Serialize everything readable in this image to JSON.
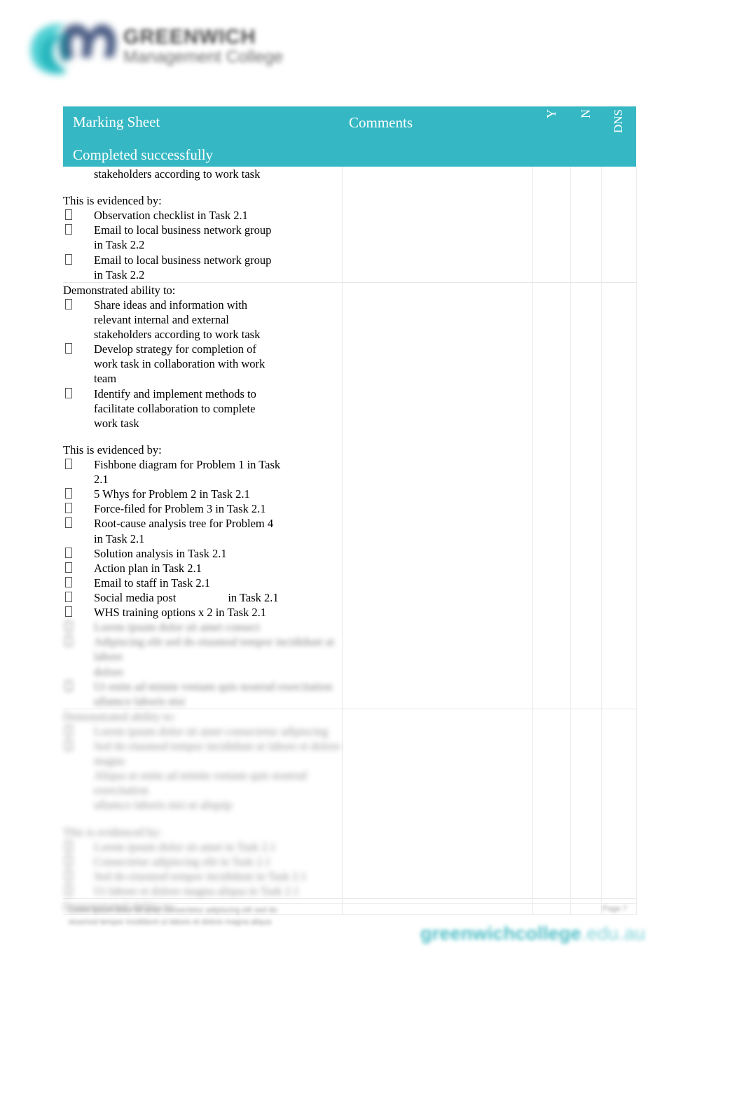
{
  "branding": {
    "logo_icon": "gm-monogram-logo",
    "name": "GREENWICH",
    "tagline": "Management College",
    "mark_colors": [
      "#3bc3c9",
      "#2aa6b4",
      "#4a5b80",
      "#6f7fa3"
    ]
  },
  "colors": {
    "header_teal": "#36b8c4",
    "footer_url_teal": "#4dbec6",
    "text": "#000000",
    "grid": "#e9e9e9"
  },
  "table": {
    "headers": {
      "title_line1": "Marking Sheet",
      "title_line2": "Completed successfully",
      "comments": "Comments",
      "yes": "Y",
      "no": "N",
      "dns": "DNS"
    },
    "rows": [
      {
        "id": "row-1",
        "continuation_line": "stakeholders according to work task",
        "evidence_lead": "This is evidenced by:",
        "evidence_items": [
          [
            "Observation checklist in Task 2.1"
          ],
          [
            "Email to local business network group",
            "in Task 2.2"
          ],
          [
            "Email to local business network group",
            "in Task 2.2"
          ]
        ]
      },
      {
        "id": "row-2",
        "ability_lead": "Demonstrated ability to:",
        "ability_items": [
          [
            "Share ideas and information with",
            "relevant internal and external",
            "stakeholders according to work task"
          ],
          [
            "Develop strategy for completion of",
            "work task in collaboration with work",
            "team"
          ],
          [
            "Identify and implement methods to",
            "facilitate collaboration to complete",
            "work task"
          ]
        ],
        "evidence_lead": "This is evidenced by:",
        "evidence_items": [
          [
            "Fishbone diagram for Problem 1 in Task",
            "2.1"
          ],
          [
            "5 Whys for Problem 2 in Task 2.1"
          ],
          [
            "Force-filed for Problem 3 in Task 2.1"
          ],
          [
            "Root-cause analysis tree for Problem 4",
            "in Task 2.1"
          ],
          [
            "Solution analysis in Task 2.1"
          ],
          [
            "Action plan in Task 2.1"
          ],
          [
            "Email to staff in Task 2.1"
          ],
          [
            "Social media post",
            "in Task 2.1"
          ],
          [
            "WHS training options x 2 in Task 2.1"
          ]
        ],
        "illegible_tail": [
          "Lorem ipsum dolor sit amet consect",
          "Adipiscing elit sed do eiusmod tempor incididunt ut labore",
          "dolore",
          "Ut enim ad minim veniam quis nostrud exercitation",
          "ullamco laboris nisi"
        ]
      },
      {
        "id": "row-3",
        "illegible_lead": "Demonstrated ability to:",
        "illegible_body": [
          "Lorem ipsum dolor sit amet consectetur adipiscing",
          "Sed do eiusmod tempor incididunt ut labore et dolore magna",
          "Aliqua ut enim ad minim veniam quis nostrud exercitation",
          "ullamco laboris nisi ut aliquip",
          "",
          "This is evidenced by:",
          "Lorem ipsum dolor sit amet in Task 2.1",
          "Consectetur adipiscing elit in Task 2.1",
          "Sed do eiusmod tempor incididunt in Task 2.1",
          "Ut labore et dolore magna aliqua in Task 2.1"
        ],
        "footer_line": "Demonstrated ability to:"
      }
    ]
  },
  "footer": {
    "doc_line1": "Lorem ipsum dolor sit amet consectetur adipiscing elit sed do",
    "doc_line2": "eiusmod tempor  incididunt  ut labore  et  dolore  magna aliqua",
    "page_label": "Page 7",
    "url_main": "greenwichcollege",
    "url_tld": ".edu.au"
  }
}
